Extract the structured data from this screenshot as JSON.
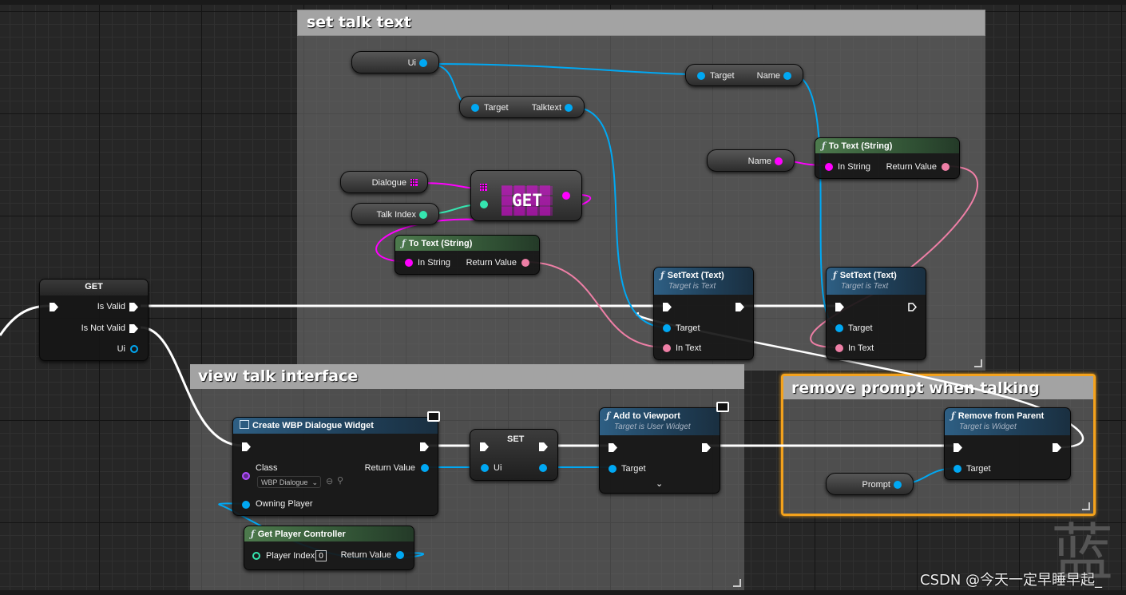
{
  "comments": {
    "talk": "set talk text",
    "view": "view talk interface",
    "prompt": "remove prompt when talking"
  },
  "nodes": {
    "get_valid": {
      "title": "GET",
      "is_valid": "Is Valid",
      "is_not_valid": "Is Not Valid",
      "ui": "Ui"
    },
    "ui_var": "Ui",
    "talktext_get": {
      "target": "Target",
      "out": "Talktext"
    },
    "name_get": {
      "target": "Target",
      "out": "Name"
    },
    "name_var": "Name",
    "to_text_top": {
      "title": "To Text (String)",
      "in": "In String",
      "out": "Return Value"
    },
    "dialogue_var": "Dialogue",
    "talk_index_var": "Talk Index",
    "array_get": {
      "label": "GET"
    },
    "to_text_mid": {
      "title": "To Text (String)",
      "in": "In String",
      "out": "Return Value"
    },
    "settext1": {
      "title": "SetText (Text)",
      "subtitle": "Target is Text",
      "target": "Target",
      "in_text": "In Text"
    },
    "settext2": {
      "title": "SetText (Text)",
      "subtitle": "Target is Text",
      "target": "Target",
      "in_text": "In Text"
    },
    "create_widget": {
      "title": "Create WBP Dialogue Widget",
      "class": "Class",
      "class_value": "WBP Dialogue",
      "owning_player": "Owning Player",
      "return_value": "Return Value"
    },
    "set_ui": {
      "title": "SET",
      "ui": "Ui"
    },
    "add_viewport": {
      "title": "Add to Viewport",
      "subtitle": "Target is User Widget",
      "target": "Target"
    },
    "get_player_controller": {
      "title": "Get Player Controller",
      "player_index": "Player Index",
      "player_index_value": "0",
      "return_value": "Return Value"
    },
    "remove_parent": {
      "title": "Remove from Parent",
      "subtitle": "Target is Widget",
      "target": "Target"
    },
    "prompt_var": "Prompt"
  },
  "watermark": "CSDN @今天一定早睡早起_",
  "deco_glyph": "蓝",
  "colors": {
    "object_pin": "#00a8f3",
    "string_pin": "#ff00ff",
    "text_pin": "#ee7fa6",
    "int_pin": "#35e6b0",
    "exec": "#ffffff",
    "selection": "#f4a21c"
  },
  "icons": [
    "function-icon",
    "widget-class-icon",
    "monitor-icon",
    "array-grid-icon",
    "chevron-down-icon",
    "browse-icon",
    "search-icon"
  ]
}
